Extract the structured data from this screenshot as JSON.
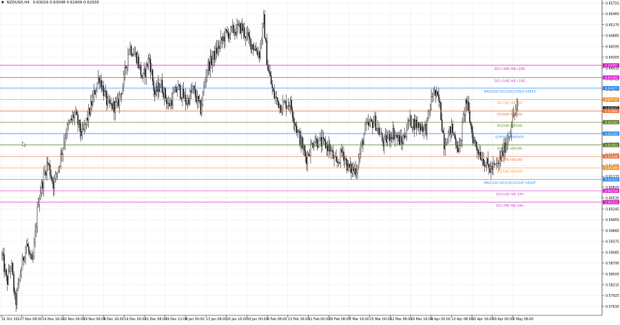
{
  "header": {
    "symbol_label": "NZDUSD,H4",
    "ohlc_label": "0.63029 0.63048 0.62909 0.62935",
    "menu_icon": "triangle-down-icon"
  },
  "colors": {
    "background": "#ffffff",
    "grid": "#e8e8e8",
    "candle_up": "#ffffff",
    "candle_down": "#000000",
    "candle_wick": "#000000"
  },
  "chart_data": {
    "type": "candlestick",
    "ylim": [
      0.5745,
      0.6578
    ],
    "grid": true,
    "price_axis_labels": [
      "0.65755",
      "0.65465",
      "0.65175",
      "0.64885",
      "0.64595",
      "0.64305",
      "0.64015",
      "0.63725",
      "0.63435",
      "0.63145",
      "0.62855",
      "0.62565",
      "0.62275",
      "0.61985",
      "0.61695",
      "0.61405",
      "0.61115",
      "0.60825",
      "0.60535",
      "0.60245",
      "0.59955",
      "0.59665",
      "0.59375",
      "0.59085",
      "0.58795",
      "0.58505",
      "0.58215",
      "0.57925",
      "0.57635"
    ],
    "time_axis_labels": [
      "31 Oct 2022",
      "7 Nov 08:00",
      "14 Nov 16:00",
      "22 Nov 00:00",
      "29 Nov 08:00",
      "6 Dec 16:00",
      "14 Dec 00:00",
      "21 Dec 08:00",
      "29 Dec 12:00",
      "6 Jan 00:00",
      "13 Jan 08:00",
      "20 Jan 16:00",
      "30 Jan 00:00",
      "6 Feb 08:00",
      "13 Feb 16:00",
      "21 Feb 00:00",
      "28 Feb 08:00",
      "7 Mar 16:00",
      "15 Mar 00:00",
      "22 Mar 08:00",
      "29 Mar 16:00",
      "6 Apr 00:00",
      "13 Apr 08:00",
      "20 Apr 16:00",
      "28 Apr 00:00",
      "5 May 08:00"
    ],
    "price_path": [
      [
        0,
        0.59
      ],
      [
        0.008,
        0.5825
      ],
      [
        0.015,
        0.588
      ],
      [
        0.022,
        0.5768
      ],
      [
        0.03,
        0.585
      ],
      [
        0.04,
        0.5935
      ],
      [
        0.05,
        0.587
      ],
      [
        0.06,
        0.605
      ],
      [
        0.075,
        0.615
      ],
      [
        0.085,
        0.609
      ],
      [
        0.095,
        0.615
      ],
      [
        0.105,
        0.623
      ],
      [
        0.12,
        0.628
      ],
      [
        0.132,
        0.622
      ],
      [
        0.145,
        0.629
      ],
      [
        0.16,
        0.638
      ],
      [
        0.175,
        0.63
      ],
      [
        0.19,
        0.63
      ],
      [
        0.2,
        0.636
      ],
      [
        0.21,
        0.646
      ],
      [
        0.223,
        0.643
      ],
      [
        0.232,
        0.637
      ],
      [
        0.243,
        0.643
      ],
      [
        0.252,
        0.633
      ],
      [
        0.262,
        0.636
      ],
      [
        0.275,
        0.63
      ],
      [
        0.29,
        0.635
      ],
      [
        0.305,
        0.631
      ],
      [
        0.315,
        0.6345
      ],
      [
        0.328,
        0.629
      ],
      [
        0.338,
        0.64
      ],
      [
        0.352,
        0.644
      ],
      [
        0.368,
        0.649
      ],
      [
        0.38,
        0.65
      ],
      [
        0.395,
        0.651
      ],
      [
        0.41,
        0.647
      ],
      [
        0.425,
        0.644
      ],
      [
        0.432,
        0.653
      ],
      [
        0.438,
        0.641
      ],
      [
        0.448,
        0.633
      ],
      [
        0.46,
        0.63
      ],
      [
        0.475,
        0.631
      ],
      [
        0.488,
        0.623
      ],
      [
        0.502,
        0.616
      ],
      [
        0.515,
        0.621
      ],
      [
        0.528,
        0.62
      ],
      [
        0.54,
        0.619
      ],
      [
        0.552,
        0.614
      ],
      [
        0.562,
        0.618
      ],
      [
        0.572,
        0.613
      ],
      [
        0.585,
        0.613
      ],
      [
        0.6,
        0.624
      ],
      [
        0.615,
        0.626
      ],
      [
        0.63,
        0.62
      ],
      [
        0.645,
        0.623
      ],
      [
        0.66,
        0.62
      ],
      [
        0.672,
        0.626
      ],
      [
        0.685,
        0.625
      ],
      [
        0.7,
        0.624
      ],
      [
        0.712,
        0.634
      ],
      [
        0.722,
        0.631
      ],
      [
        0.73,
        0.62
      ],
      [
        0.742,
        0.624
      ],
      [
        0.755,
        0.618
      ],
      [
        0.766,
        0.632
      ],
      [
        0.778,
        0.621
      ],
      [
        0.79,
        0.617
      ],
      [
        0.805,
        0.613
      ],
      [
        0.818,
        0.614
      ],
      [
        0.828,
        0.618
      ],
      [
        0.838,
        0.623
      ],
      [
        0.845,
        0.628
      ],
      [
        0.852,
        0.6294
      ]
    ],
    "levels": [
      {
        "label": "D1[+3/8] H4[+2/8]",
        "price_tag": "0.64087",
        "price": 0.64087,
        "color": "#cc1bb7",
        "style": "solid"
      },
      {
        "label": "D1[+1/8] H4[+1/8]",
        "price_tag": "0.63762",
        "price": 0.63762,
        "color": "#e020d8",
        "style": "solid"
      },
      {
        "label": "MN1[2/8] W1[2/8] D1RES H4RES",
        "price_tag": "0.63477",
        "price": 0.63477,
        "color": "#2a8cf0",
        "style": "solid"
      },
      {
        "label": "D1[7/8] H4[7/8]",
        "price_tag": "0.63173",
        "price": 0.63173,
        "color": "#f09a30",
        "style": "solid"
      },
      {
        "label": "",
        "price_tag": "0.62935",
        "price": 0.62935,
        "color": "#222222",
        "style": "current"
      },
      {
        "label": "D1[6/8] H4[6/8]",
        "price_tag": "0.62866",
        "price": 0.62866,
        "color": "#f06a30",
        "style": "solid"
      },
      {
        "label": "D1[5/8] H4[5/8]",
        "price_tag": "0.62565",
        "price": 0.62565,
        "color": "#5a7a20",
        "style": "solid"
      },
      {
        "label": "D1PIVOT H4PIVOT",
        "price_tag": "0.62260",
        "price": 0.6226,
        "color": "#2a8cf0",
        "style": "solid"
      },
      {
        "label": "D1[3/8] H4[3/8]",
        "price_tag": "0.61953",
        "price": 0.61953,
        "color": "#5a7a20",
        "style": "solid"
      },
      {
        "label": "D1[2/8] H4[2/8]",
        "price_tag": "0.61648",
        "price": 0.61648,
        "color": "#f06a30",
        "style": "solid"
      },
      {
        "label": "D1[1/8] H4[1/8]",
        "price_tag": "0.61340",
        "price": 0.6134,
        "color": "#f09a30",
        "style": "solid"
      },
      {
        "label": "MN1[1/8] W1[1/8] D1SUP H4SUP",
        "price_tag": "0.61033",
        "price": 0.61033,
        "color": "#2a8cf0",
        "style": "solid"
      },
      {
        "label": "D1[-1/8] H4[-1/8]",
        "price_tag": "0.60729",
        "price": 0.60729,
        "color": "#e020d8",
        "style": "solid"
      },
      {
        "label": "D1[-2/8] H4[-2/8]",
        "price_tag": "0.60425",
        "price": 0.60425,
        "color": "#cc1bb7",
        "style": "solid"
      }
    ]
  }
}
